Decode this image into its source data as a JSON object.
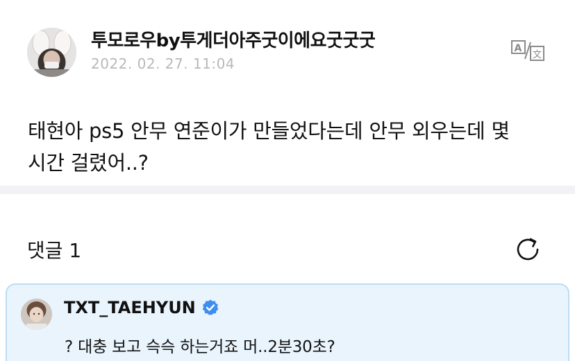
{
  "post": {
    "author_name": "투모로우by투게더아주굿이에요굿굿굿",
    "timestamp": "2022. 02. 27. 11:04",
    "translate_icon": "translate-icon",
    "body_line1": "태현아 ps5 안무 연준이가 만들었다는데 안무 외우는데 몇",
    "body_line2": "시간 걸렸어..?"
  },
  "comments": {
    "title": "댓글 1",
    "refresh_icon": "refresh-icon",
    "items": [
      {
        "author": "TXT_TAEHYUN",
        "verified_icon": "verified-badge-icon",
        "text": "? 대충 보고 슥슥 하는거죠 머..2분30초?"
      }
    ]
  },
  "colors": {
    "comment_bg": "#e9f4fd",
    "comment_border": "#bcdcf4",
    "verified_blue": "#3e8ef0",
    "timestamp_gray": "#b8b8b8",
    "divider_gray": "#f2f2f4"
  }
}
